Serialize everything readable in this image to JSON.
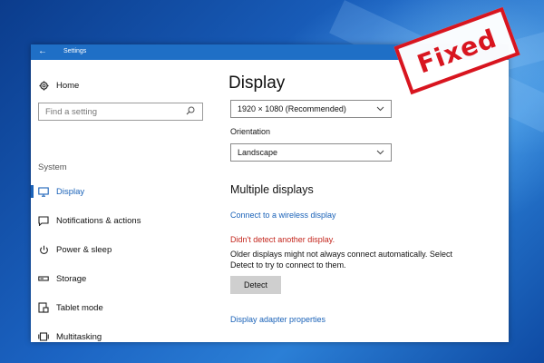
{
  "window": {
    "title": "Settings",
    "back_icon": "back-arrow-icon"
  },
  "sidebar": {
    "home": {
      "label": "Home",
      "icon": "gear-icon"
    },
    "search": {
      "placeholder": "Find a setting",
      "icon": "search-icon"
    },
    "group_label": "System",
    "items": [
      {
        "label": "Display",
        "icon": "monitor-icon",
        "selected": true
      },
      {
        "label": "Notifications & actions",
        "icon": "message-icon",
        "selected": false
      },
      {
        "label": "Power & sleep",
        "icon": "power-icon",
        "selected": false
      },
      {
        "label": "Storage",
        "icon": "storage-icon",
        "selected": false
      },
      {
        "label": "Tablet mode",
        "icon": "tablet-icon",
        "selected": false
      },
      {
        "label": "Multitasking",
        "icon": "multitasking-icon",
        "selected": false
      }
    ]
  },
  "main": {
    "title": "Display",
    "resolution": {
      "value": "1920 × 1080 (Recommended)"
    },
    "orientation": {
      "label": "Orientation",
      "value": "Landscape"
    },
    "multiple_displays": {
      "title": "Multiple displays",
      "wireless_link": "Connect to a wireless display",
      "error": "Didn't detect another display.",
      "info": "Older displays might not always connect automatically. Select Detect to try to connect to them.",
      "detect_button": "Detect",
      "adapter_link": "Display adapter properties"
    }
  },
  "overlay": {
    "stamp": "Fixed"
  },
  "colors": {
    "accent": "#1a62b8",
    "error": "#c4261d",
    "titlebar": "#1f6fc6",
    "stamp": "#d8151f"
  }
}
